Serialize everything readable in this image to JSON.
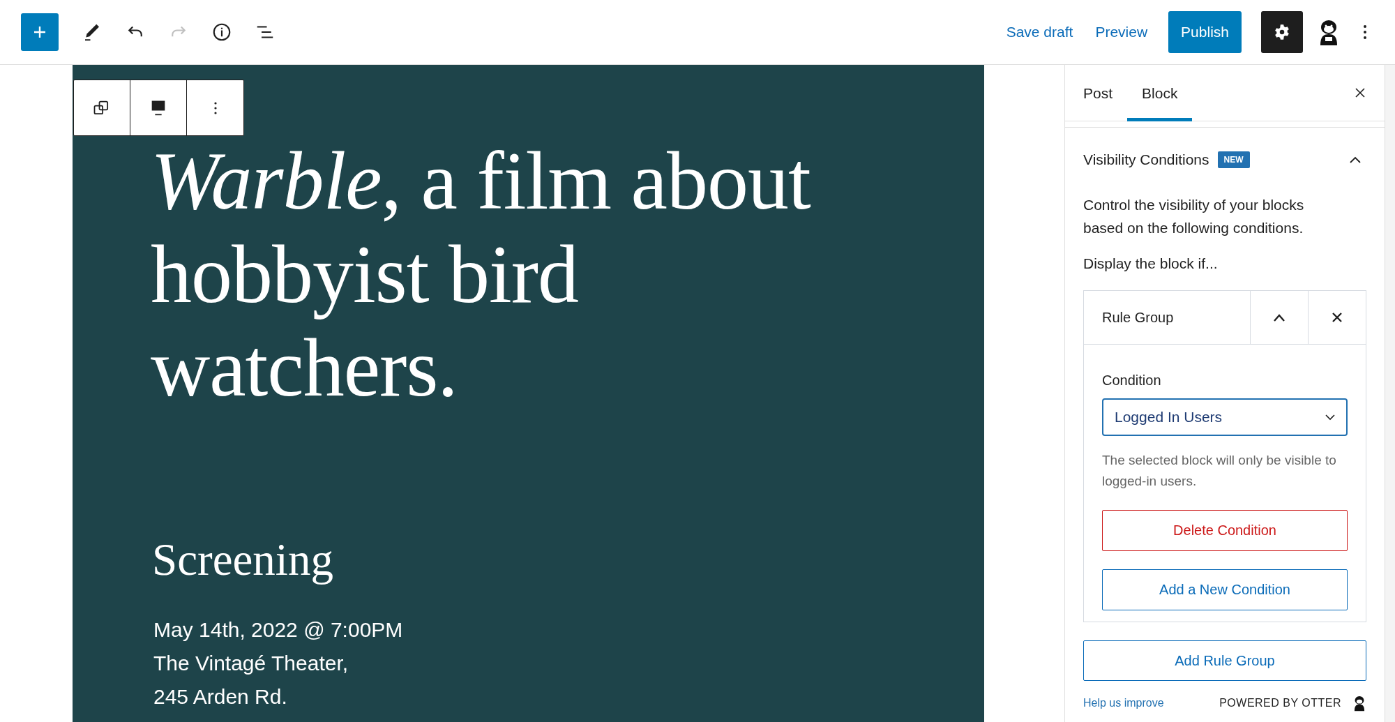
{
  "header": {
    "tools": [
      {
        "kind": "inserter",
        "disabled": false
      },
      {
        "kind": "edit",
        "disabled": false
      },
      {
        "kind": "undo",
        "disabled": false
      },
      {
        "kind": "redo",
        "disabled": true
      },
      {
        "kind": "info",
        "disabled": false
      },
      {
        "kind": "list",
        "disabled": false
      }
    ],
    "save_draft": "Save draft",
    "preview": "Preview",
    "publish": "Publish",
    "settings": {
      "selected": true
    }
  },
  "block_toolbar": {
    "tools": [
      {
        "kind": "duplicate"
      },
      {
        "kind": "align"
      },
      {
        "kind": "more"
      }
    ]
  },
  "canvas": {
    "heading": "*Warble*, a film about hobbyist bird watchers.",
    "subheading": "Screening",
    "details": [
      "May 14th, 2022 @ 7:00PM",
      "The Vintagé Theater,",
      "245 Arden Rd."
    ]
  },
  "sidebar": {
    "tabs": [
      {
        "label": "Post",
        "selected": false
      },
      {
        "label": "Block",
        "selected": true
      }
    ],
    "panel": {
      "title": "Visibility Conditions",
      "badge": "NEW",
      "expanded": true,
      "description": "Control the visibility of your blocks based on the following conditions.",
      "display_if": "Display the block if...",
      "rule_group": {
        "title": "Rule Group",
        "condition_label": "Condition",
        "condition_value": "Logged In Users",
        "help": "The selected block will only be visible to logged-in users.",
        "delete_button": "Delete Condition",
        "add_condition_button": "Add a New Condition"
      },
      "add_rule_group": "Add Rule Group"
    },
    "footer": {
      "help_link": "Help us improve",
      "powered_by": "POWERED BY OTTER"
    }
  }
}
